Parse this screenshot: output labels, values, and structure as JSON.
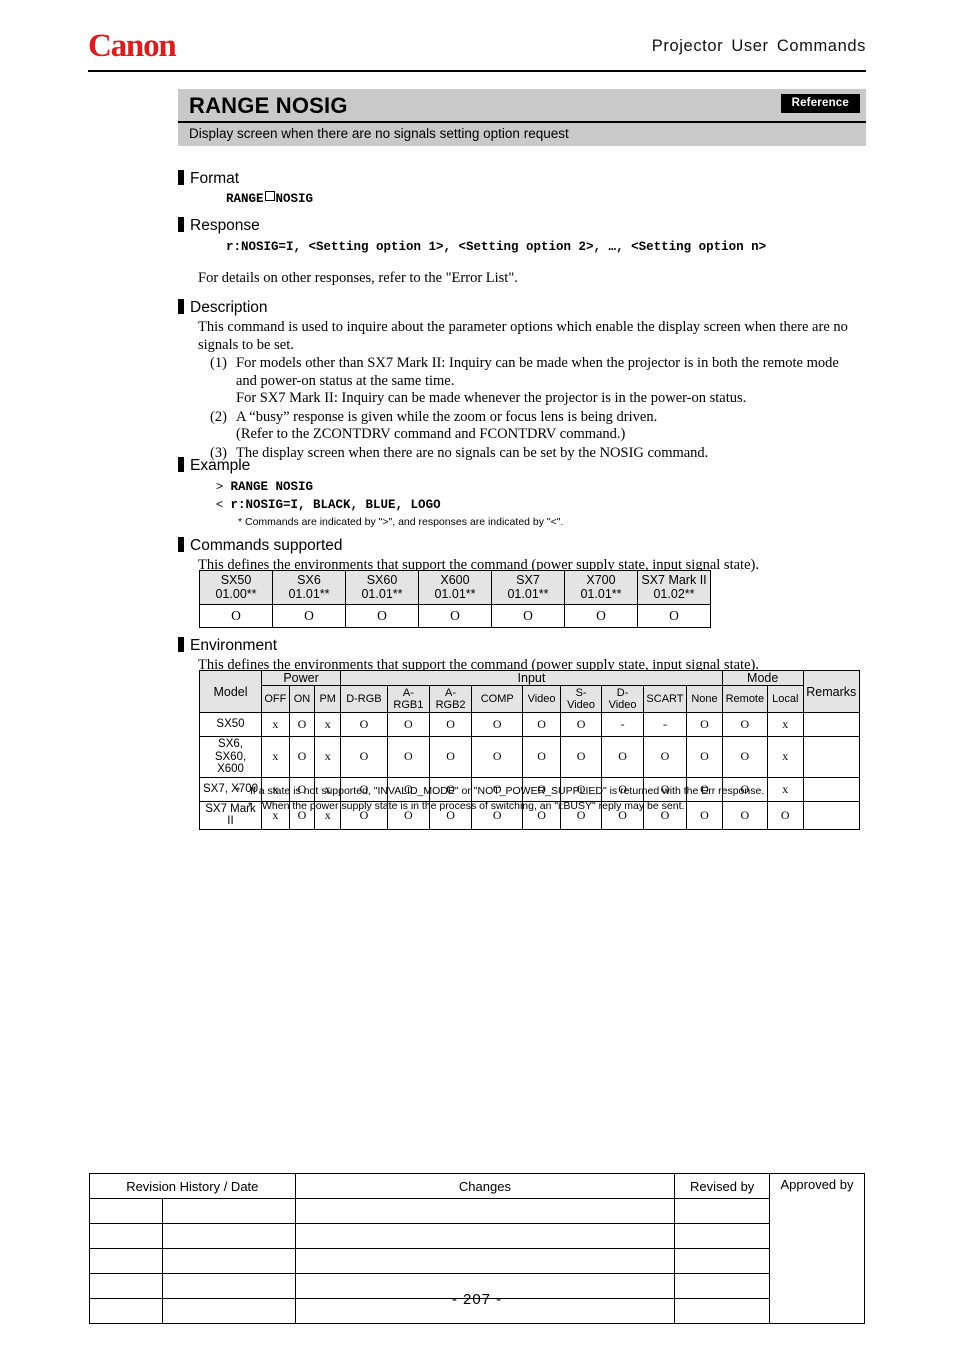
{
  "header": {
    "logo_text": "Canon",
    "logo_color": "#d81e1e",
    "title": "Projector User Commands"
  },
  "title_band": {
    "command_title": "RANGE NOSIG",
    "badge_label": "Reference",
    "subtitle": "Display screen when there are no signals setting option request"
  },
  "sections": {
    "format": {
      "heading": "Format",
      "syntax_before": "RANGE",
      "syntax_after": "NOSIG"
    },
    "response": {
      "heading": "Response",
      "syntax": "r:NOSIG=I, <Setting option 1>, <Setting option 2>, …, <Setting option n>",
      "note": "For details on other responses, refer to the \"Error List\"."
    },
    "description": {
      "heading": "Description",
      "intro_line1": "This command is used to inquire about the parameter options which enable the display screen when there are no",
      "intro_line2": "signals to be set.",
      "items": [
        {
          "num": "(1)",
          "line1": "For models other than SX7 Mark II: Inquiry can be made when the projector is in both the remote mode",
          "line2": "and power-on status at the same time.",
          "line3": "For SX7 Mark II: Inquiry can be made whenever the projector is in the power-on status."
        },
        {
          "num": "(2)",
          "line1": "A “busy” response is given while the zoom or focus lens is being driven.",
          "line2": "(Refer to the ZCONTDRV command and FCONTDRV command.)"
        },
        {
          "num": "(3)",
          "line1": "The display screen when there are no signals can be set by the NOSIG command."
        }
      ]
    },
    "example": {
      "heading": "Example",
      "request_marker": ">",
      "request": "RANGE NOSIG",
      "response_marker": "<",
      "response": "r:NOSIG=I, BLACK, BLUE, LOGO",
      "note": "* Commands are indicated by \">\", and responses are indicated by \"<\"."
    },
    "commands_supported": {
      "heading": "Commands supported",
      "intro": "This defines the environments that support the command (power supply state, input signal state)."
    },
    "environment": {
      "heading": "Environment",
      "intro": "This defines the environments that support the command (power supply state, input signal state)."
    }
  },
  "commands_table": {
    "models": [
      {
        "name": "SX50",
        "version": "01.00**",
        "support": "O"
      },
      {
        "name": "SX6",
        "version": "01.01**",
        "support": "O"
      },
      {
        "name": "SX60",
        "version": "01.01**",
        "support": "O"
      },
      {
        "name": "X600",
        "version": "01.01**",
        "support": "O"
      },
      {
        "name": "SX7",
        "version": "01.01**",
        "support": "O"
      },
      {
        "name": "X700",
        "version": "01.01**",
        "support": "O"
      },
      {
        "name": "SX7 Mark II",
        "version": "01.02**",
        "support": "O"
      }
    ]
  },
  "environment_table": {
    "group_headers": {
      "model": "Model",
      "power": "Power",
      "input": "Input",
      "mode": "Mode",
      "remarks": "Remarks"
    },
    "sub_headers": [
      "OFF",
      "ON",
      "PM",
      "D-RGB",
      "A-RGB1",
      "A-RGB2",
      "COMP",
      "Video",
      "S-Video",
      "D-Video",
      "SCART",
      "None",
      "Remote",
      "Local"
    ],
    "rows": [
      {
        "model": "SX50",
        "values": [
          "x",
          "O",
          "x",
          "O",
          "O",
          "O",
          "O",
          "O",
          "O",
          "-",
          "-",
          "O",
          "O",
          "x"
        ],
        "remarks": ""
      },
      {
        "model": "SX6, SX60, X600",
        "model_line1": "SX6, SX60,",
        "model_line2": "X600",
        "values": [
          "x",
          "O",
          "x",
          "O",
          "O",
          "O",
          "O",
          "O",
          "O",
          "O",
          "O",
          "O",
          "O",
          "x"
        ],
        "remarks": ""
      },
      {
        "model": "SX7, X700",
        "values": [
          "x",
          "O",
          "x",
          "O",
          "O",
          "O",
          "O",
          "O",
          "O",
          "O",
          "O",
          "O",
          "O",
          "x"
        ],
        "remarks": ""
      },
      {
        "model": "SX7 Mark II",
        "values": [
          "x",
          "O",
          "x",
          "O",
          "O",
          "O",
          "O",
          "O",
          "O",
          "O",
          "O",
          "O",
          "O",
          "O"
        ],
        "remarks": ""
      }
    ],
    "footnotes": [
      "If a state is not supported, \"INVALID_MODE\" or \"NOT_POWER_SUPPLIED\" is returned with the Err response.",
      "When the power supply state is in the process of switching, an \"i:BUSY\" reply may be sent."
    ]
  },
  "revision_table": {
    "headers": [
      "Revision History / Date",
      "Changes",
      "Revised by",
      "Approved by"
    ],
    "rows": [
      {
        "date_a": "",
        "date_b": "",
        "changes": "",
        "revised_by": ""
      },
      {
        "date_a": "",
        "date_b": "",
        "changes": "",
        "revised_by": ""
      },
      {
        "date_a": "",
        "date_b": "",
        "changes": "",
        "revised_by": ""
      },
      {
        "date_a": "",
        "date_b": "",
        "changes": "",
        "revised_by": ""
      },
      {
        "date_a": "",
        "date_b": "",
        "changes": "",
        "revised_by": ""
      }
    ],
    "approved_by_cell": ""
  },
  "footer": {
    "page_number": "- 207 -"
  }
}
